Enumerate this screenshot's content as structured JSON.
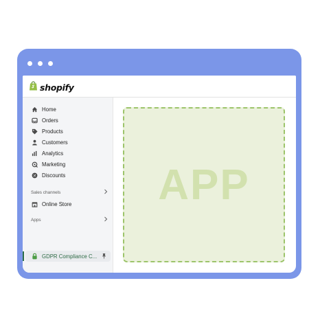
{
  "colors": {
    "window_frame": "#7b96e8",
    "sidebar_bg": "#f4f5f7",
    "app_area_bg": "#ebf1dc",
    "app_area_border": "#9cc46a",
    "app_text": "#d2e1ae",
    "selected_app_text": "#2e6b46",
    "shopify_green": "#95bf47"
  },
  "window": {
    "dots": [
      "dot",
      "dot",
      "dot"
    ]
  },
  "header": {
    "logo_text": "shopify",
    "logo_icon": "shopify-bag-icon"
  },
  "sidebar": {
    "items": [
      {
        "label": "Home",
        "icon": "home-icon"
      },
      {
        "label": "Orders",
        "icon": "orders-inbox-icon"
      },
      {
        "label": "Products",
        "icon": "tag-icon"
      },
      {
        "label": "Customers",
        "icon": "person-icon"
      },
      {
        "label": "Analytics",
        "icon": "bar-chart-icon"
      },
      {
        "label": "Marketing",
        "icon": "target-icon"
      },
      {
        "label": "Discounts",
        "icon": "discount-icon"
      }
    ],
    "sales_channels": {
      "heading": "Sales channels",
      "chevron": "chevron-right-icon",
      "items": [
        {
          "label": "Online Store",
          "icon": "store-icon"
        }
      ]
    },
    "apps": {
      "heading": "Apps",
      "chevron": "chevron-right-icon",
      "items": [
        {
          "label": "GDPR Compliance C...",
          "icon": "lock-icon",
          "pin_icon": "pin-icon",
          "selected": true
        }
      ]
    }
  },
  "main": {
    "placeholder_text": "APP"
  }
}
